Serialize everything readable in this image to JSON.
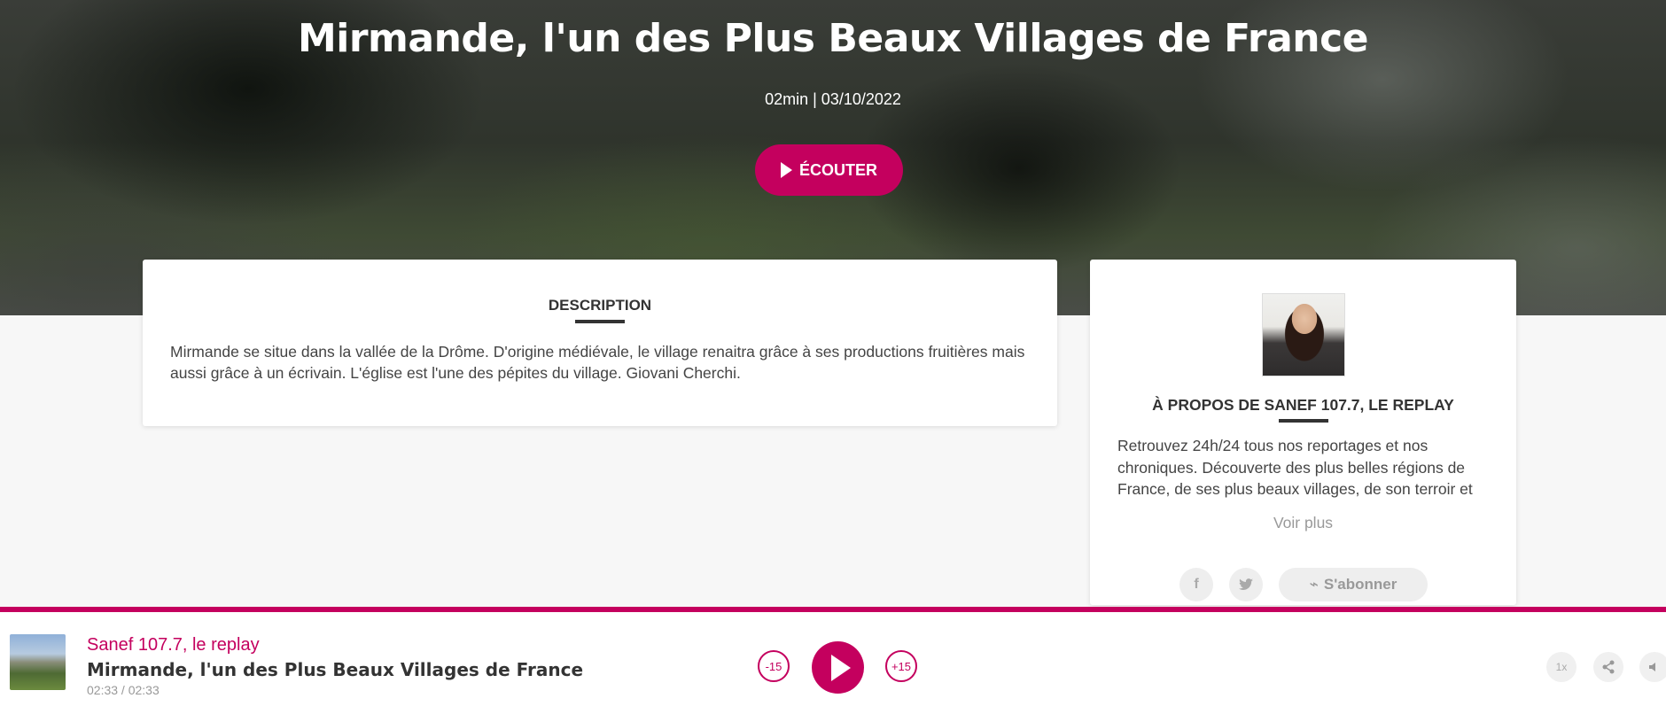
{
  "hero": {
    "title": "Mirmande, l'un des Plus Beaux Villages de France",
    "meta": "02min | 03/10/2022",
    "listen_label": "ÉCOUTER"
  },
  "description": {
    "heading": "DESCRIPTION",
    "text": "Mirmande se situe dans la vallée de la Drôme. D'origine médiévale, le village renaitra grâce à ses productions fruitières mais aussi grâce à un écrivain. L'église est l'une des pépites du village. Giovani Cherchi."
  },
  "about": {
    "heading": "À PROPOS DE SANEF 107.7, LE REPLAY",
    "text": "Retrouvez 24h/24 tous nos reportages et nos chroniques. Découverte des plus belles régions de France, de ses plus beaux villages, de son terroir et",
    "more_label": "Voir plus",
    "facebook_icon": "f",
    "twitter_icon": "🐦",
    "subscribe_label": "S'abonner",
    "rss_icon": "⌁"
  },
  "player": {
    "show": "Sanef 107.7, le replay",
    "title": "Mirmande, l'un des Plus Beaux Villages de France",
    "time": "02:33 / 02:33",
    "skip_back": "-15",
    "skip_forward": "+15",
    "speed": "1x",
    "share_icon": "share",
    "volume_icon": "volume",
    "accent_color": "#c4005e"
  }
}
